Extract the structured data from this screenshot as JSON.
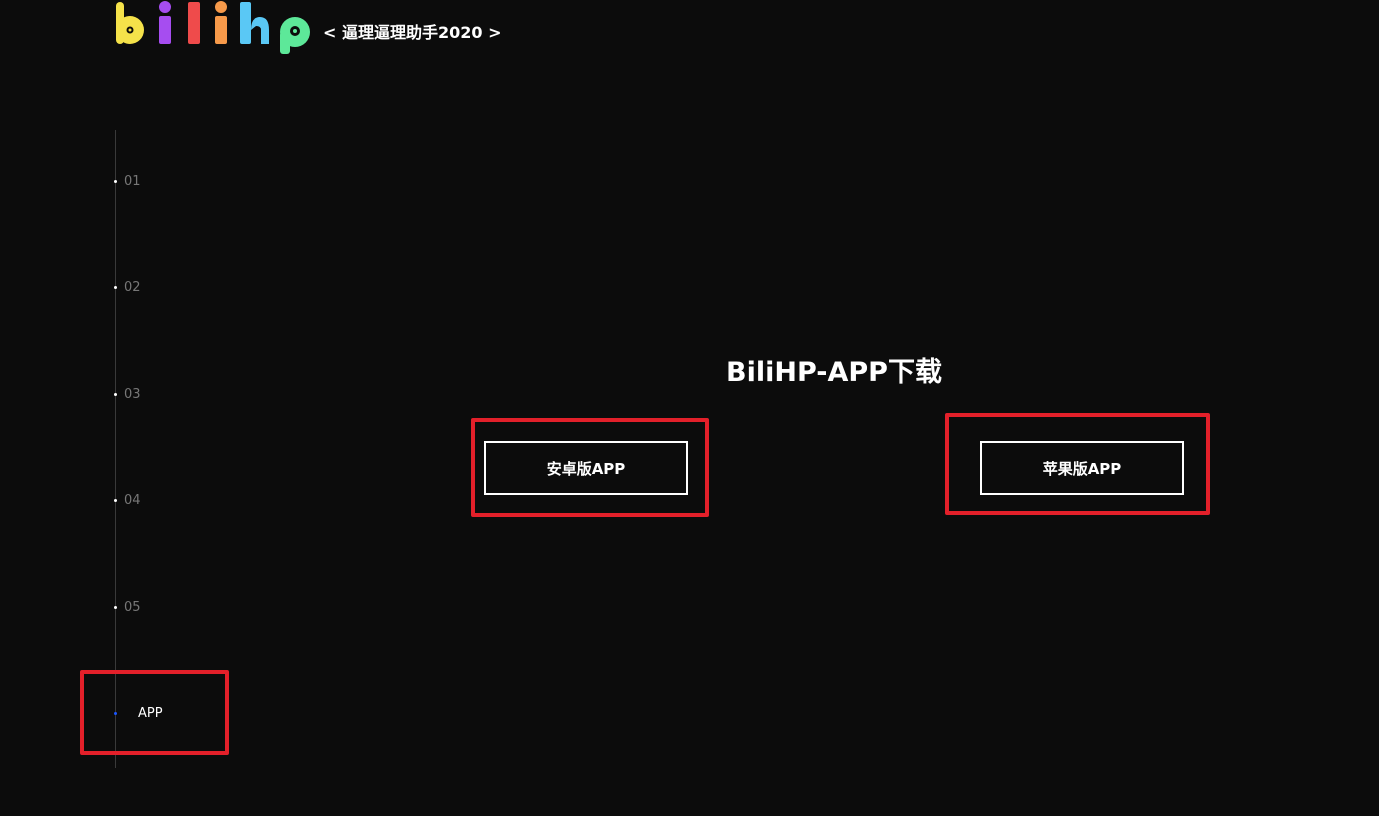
{
  "header": {
    "logo_text": "bilihp",
    "subtitle": "< 逼理逼理助手2020 >"
  },
  "nav": {
    "items": [
      {
        "label": "01"
      },
      {
        "label": "02"
      },
      {
        "label": "03"
      },
      {
        "label": "04"
      },
      {
        "label": "05"
      },
      {
        "label": "APP"
      }
    ],
    "active_label": "APP"
  },
  "main": {
    "title": "BiliHP-APP下载",
    "android_button": "安卓版APP",
    "ios_button": "苹果版APP"
  },
  "colors": {
    "background": "#0c0c0c",
    "text": "#ffffff",
    "nav_inactive": "#777777",
    "active_dot": "#1a56ff",
    "highlight": "#e3202a",
    "logo_b": "#f5e24a",
    "logo_i1": "#a64df0",
    "logo_l": "#ef4b4b",
    "logo_i2": "#f79a4a",
    "logo_h": "#5ac8f5",
    "logo_p": "#5de899"
  }
}
